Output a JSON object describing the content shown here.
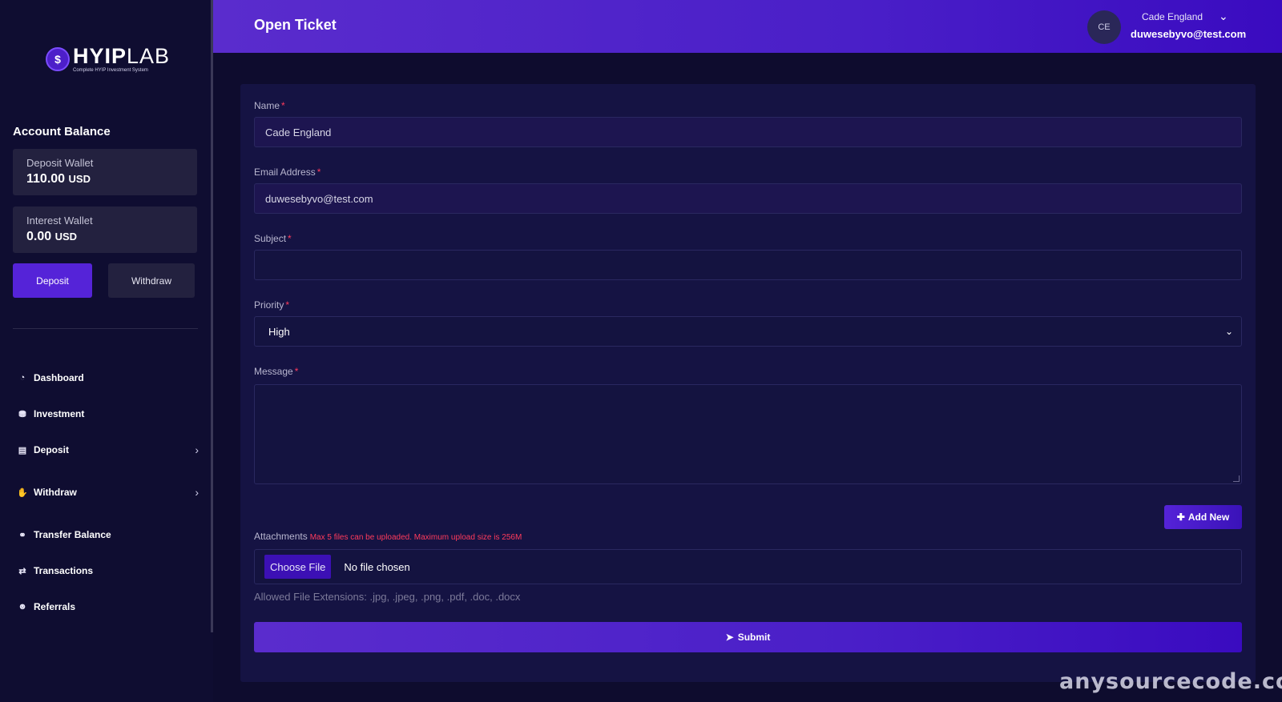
{
  "logo": {
    "text_bold": "HYIP",
    "text_light": "LAB",
    "subtitle": "Complete HYIP Investment System"
  },
  "sidebar": {
    "balance_title": "Account Balance",
    "wallets": [
      {
        "label": "Deposit Wallet",
        "amount": "110.00",
        "currency": "USD"
      },
      {
        "label": "Interest Wallet",
        "amount": "0.00",
        "currency": "USD"
      }
    ],
    "deposit_button": "Deposit",
    "withdraw_button": "Withdraw",
    "nav": [
      {
        "label": "Dashboard",
        "icon": "gauge-icon"
      },
      {
        "label": "Investment",
        "icon": "invest-icon"
      },
      {
        "label": "Deposit",
        "icon": "wallet-icon",
        "has_submenu": true
      },
      {
        "label": "Withdraw",
        "icon": "hand-money-icon",
        "has_submenu": true
      },
      {
        "label": "Transfer Balance",
        "icon": "handshake-icon"
      },
      {
        "label": "Transactions",
        "icon": "exchange-icon"
      },
      {
        "label": "Referrals",
        "icon": "users-icon"
      }
    ]
  },
  "header": {
    "title": "Open Ticket",
    "avatar_initials": "CE",
    "user_name": "Cade England",
    "user_email": "duwesebyvo@test.com"
  },
  "form": {
    "name_label": "Name",
    "name_value": "Cade England",
    "email_label": "Email Address",
    "email_value": "duwesebyvo@test.com",
    "subject_label": "Subject",
    "subject_value": "",
    "priority_label": "Priority",
    "priority_value": "High",
    "message_label": "Message",
    "required_mark": "*",
    "add_new_button": "Add New",
    "attachments_label": "Attachments",
    "attachments_note": "Max 5 files can be uploaded. Maximum upload size is 256M",
    "file_button": "Choose File",
    "file_status": "No file chosen",
    "allowed_extensions": "Allowed File Extensions: .jpg, .jpeg, .png, .pdf, .doc, .docx",
    "submit_button": "Submit"
  },
  "watermark": "anysourcecode.com",
  "colors": {
    "accent": "#5523d8",
    "required": "#ff3b5c",
    "background": "#0e0c2e"
  }
}
